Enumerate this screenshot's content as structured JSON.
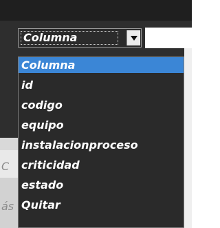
{
  "select": {
    "value": "Columna",
    "arrow_icon": "chevron-down-icon"
  },
  "dropdown": {
    "options": [
      "Columna",
      "id",
      "codigo",
      "equipo",
      "instalacionproceso",
      "criticidad",
      "estado",
      "Quitar"
    ],
    "selected_index": 0,
    "highlight_color": "#3b86d6"
  },
  "background": {
    "partial_text_1": "C",
    "partial_text_2": "ás"
  }
}
